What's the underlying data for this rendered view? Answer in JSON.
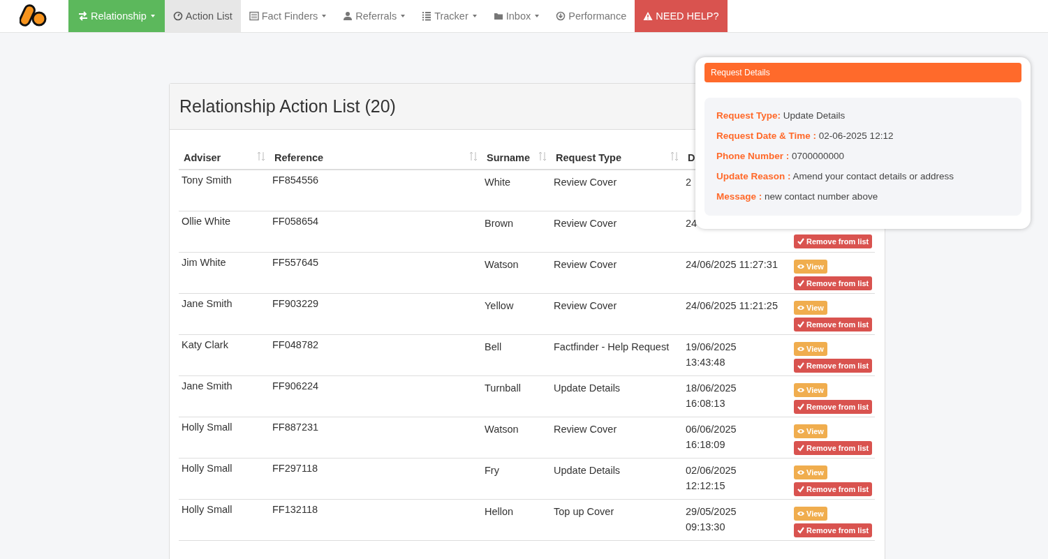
{
  "nav": {
    "items": [
      {
        "label": "Relationship",
        "kind": "primary",
        "dropdown": true
      },
      {
        "label": "Action List",
        "kind": "current",
        "dropdown": false
      },
      {
        "label": "Fact Finders",
        "kind": "normal",
        "dropdown": true
      },
      {
        "label": "Referrals",
        "kind": "normal",
        "dropdown": true
      },
      {
        "label": "Tracker",
        "kind": "normal",
        "dropdown": true
      },
      {
        "label": "Inbox",
        "kind": "normal",
        "dropdown": true
      },
      {
        "label": "Performance",
        "kind": "normal",
        "dropdown": false
      },
      {
        "label": "NEED HELP?",
        "kind": "danger",
        "dropdown": false
      }
    ]
  },
  "panel": {
    "title": "Relationship Action List (20)"
  },
  "table": {
    "columns": [
      {
        "label": "Adviser"
      },
      {
        "label": "Reference"
      },
      {
        "label": "Surname"
      },
      {
        "label": "Request Type"
      },
      {
        "label": "D"
      }
    ],
    "rows": [
      {
        "adviser": "Tony Smith",
        "reference": "FF854556",
        "surname": "White",
        "request_type": "Review Cover",
        "date": "2"
      },
      {
        "adviser": "Ollie White",
        "reference": "FF058654",
        "surname": "Brown",
        "request_type": "Review Cover",
        "date": "24",
        "remove": "Remove from list"
      },
      {
        "adviser": "Jim White",
        "reference": "FF557645",
        "surname": "Watson",
        "request_type": "Review Cover",
        "date": "24/06/2025 11:27:31",
        "view": "View",
        "remove": "Remove from list"
      },
      {
        "adviser": "Jane Smith",
        "reference": "FF903229",
        "surname": "Yellow",
        "request_type": "Review Cover",
        "date": "24/06/2025 11:21:25",
        "view": "View",
        "remove": "Remove from list"
      },
      {
        "adviser": "Katy Clark",
        "reference": "FF048782",
        "surname": "Bell",
        "request_type": "Factfinder - Help Request",
        "date": "19/06/2025\n13:43:48",
        "view": "View",
        "remove": "Remove from list"
      },
      {
        "adviser": "Jane Smith",
        "reference": "FF906224",
        "surname": "Turnball",
        "request_type": "Update Details",
        "date": "18/06/2025\n16:08:13",
        "view": "View",
        "remove": "Remove from list"
      },
      {
        "adviser": "Holly Small",
        "reference": "FF887231",
        "surname": "Watson",
        "request_type": "Review Cover",
        "date": "06/06/2025\n16:18:09",
        "view": "View",
        "remove": "Remove from list"
      },
      {
        "adviser": "Holly Small",
        "reference": "FF297118",
        "surname": "Fry",
        "request_type": "Update Details",
        "date": "02/06/2025\n12:12:15",
        "view": "View",
        "remove": "Remove from list"
      },
      {
        "adviser": "Holly Small",
        "reference": "FF132118",
        "surname": "Hellon",
        "request_type": "Top up Cover",
        "date": "29/05/2025\n09:13:30",
        "view": "View",
        "remove": "Remove from list"
      }
    ]
  },
  "popup": {
    "title": "Request Details",
    "fields": [
      {
        "label": "Request Type:",
        "value": "Update Details"
      },
      {
        "label": "Request Date & Time :",
        "value": "02-06-2025 12:12"
      },
      {
        "label": "Phone Number :",
        "value": "0700000000"
      },
      {
        "label": "Update Reason :",
        "value": "Amend your contact details or address"
      },
      {
        "label": "Message :",
        "value": "new contact number above"
      }
    ]
  }
}
